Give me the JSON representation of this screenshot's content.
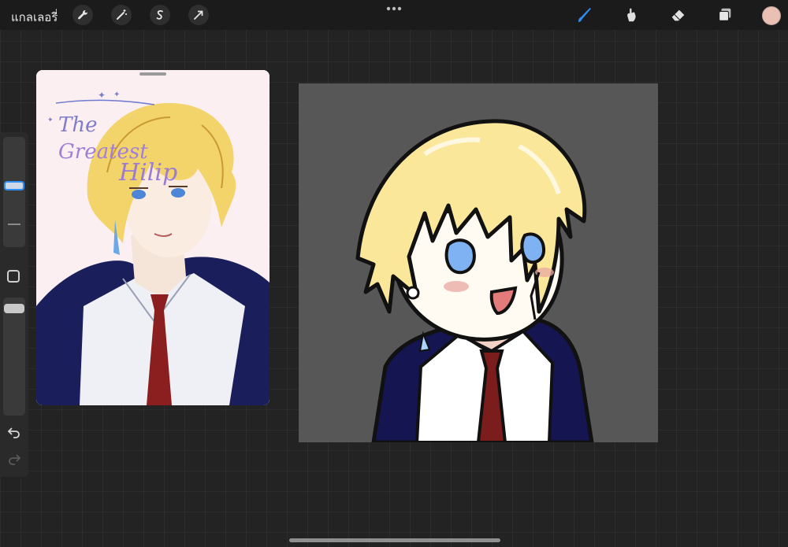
{
  "topbar": {
    "gallery_label": "แกลเลอรี่",
    "left_tools": [
      "wrench-icon",
      "magic-wand-icon",
      "selection-icon",
      "transform-arrow-icon"
    ],
    "right_tools": [
      "brush-icon",
      "smudge-icon",
      "eraser-icon",
      "layers-icon"
    ],
    "active_tool": "brush-icon",
    "accent_color": "#2f8ff5",
    "current_color": "#e9c0b3"
  },
  "sidebar": {
    "items": [
      "brush-size-slider",
      "modify-button",
      "opacity-slider",
      "undo-icon",
      "redo-icon"
    ]
  },
  "reference": {
    "title_art_text": "The Greatest Hilip",
    "palette": {
      "hair": "#f2d46a",
      "jacket": "#1a1f5c",
      "tie": "#8b1f1f",
      "shirt": "#eef0f6",
      "bg": "#fbeff2"
    }
  },
  "canvas": {
    "background": "#575757",
    "palette": {
      "hair": "#fbe79a",
      "eyes": "#7fb2f2",
      "jacket": "#151551",
      "tie": "#7c1d1d",
      "shirt": "#ffffff",
      "skin": "#fffaf2",
      "outline": "#111111"
    }
  }
}
